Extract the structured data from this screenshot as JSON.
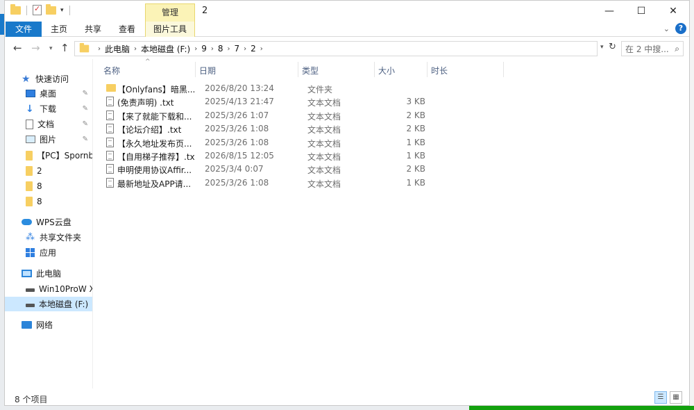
{
  "title_bar": {
    "context_tab": "管理",
    "window_title": "2",
    "minimize": "—",
    "maximize": "☐",
    "close": "✕"
  },
  "ribbon": {
    "tabs": [
      "文件",
      "主页",
      "共享",
      "查看"
    ],
    "context_tab": "图片工具",
    "expand_glyph": "⌄",
    "help_glyph": "?"
  },
  "address": {
    "back": "←",
    "forward": "→",
    "recent": "▾",
    "up": "↑",
    "crumbs": [
      "此电脑",
      "本地磁盘 (F:)",
      "9",
      "8",
      "7",
      "2"
    ],
    "dropdown": "▾",
    "refresh": "↻",
    "search_placeholder": "在 2 中搜...",
    "search_icon": "⌕"
  },
  "nav_pane": {
    "quick_access": "快速访问",
    "items": [
      {
        "label": "桌面",
        "icon": "desktop-icon"
      },
      {
        "label": "下载",
        "icon": "download-icon"
      },
      {
        "label": "文档",
        "icon": "document-icon"
      },
      {
        "label": "图片",
        "icon": "picture-icon"
      },
      {
        "label": "【PC】Spornb",
        "icon": "folder-icon"
      },
      {
        "label": "2",
        "icon": "folder-icon"
      },
      {
        "label": "8",
        "icon": "folder-icon"
      },
      {
        "label": "8",
        "icon": "folder-icon"
      }
    ],
    "wps": "WPS云盘",
    "shared": "共享文件夹",
    "apps": "应用",
    "this_pc": "此电脑",
    "drive_c": "Win10ProW X",
    "drive_f": "本地磁盘 (F:)",
    "network": "网络",
    "pin_glyph": "📌"
  },
  "columns": {
    "name": "名称",
    "date": "日期",
    "type": "类型",
    "size": "大小",
    "duration": "时长",
    "sort_glyph": "^"
  },
  "files": [
    {
      "name": "【Onlyfans】暗黑...",
      "date": "2026/8/20 13:24",
      "type": "文件夹",
      "size": "",
      "kind": "folder"
    },
    {
      "name": "(免责声明) .txt",
      "date": "2025/4/13 21:47",
      "type": "文本文档",
      "size": "3 KB",
      "kind": "file"
    },
    {
      "name": "【来了就能下载和...",
      "date": "2025/3/26 1:07",
      "type": "文本文档",
      "size": "2 KB",
      "kind": "file"
    },
    {
      "name": "【论坛介绍】.txt",
      "date": "2025/3/26 1:08",
      "type": "文本文档",
      "size": "2 KB",
      "kind": "file"
    },
    {
      "name": "【永久地址发布页...",
      "date": "2025/3/26 1:08",
      "type": "文本文档",
      "size": "1 KB",
      "kind": "file"
    },
    {
      "name": "【自用梯子推荐】.txt",
      "date": "2026/8/15 12:05",
      "type": "文本文档",
      "size": "1 KB",
      "kind": "file"
    },
    {
      "name": "申明使用协议Affir...",
      "date": "2025/3/4 0:07",
      "type": "文本文档",
      "size": "2 KB",
      "kind": "file"
    },
    {
      "name": "最新地址及APP请...",
      "date": "2025/3/26 1:08",
      "type": "文本文档",
      "size": "1 KB",
      "kind": "file"
    }
  ],
  "status": {
    "item_count": "8 个项目",
    "details_glyph": "☰",
    "tiles_glyph": "▦"
  }
}
